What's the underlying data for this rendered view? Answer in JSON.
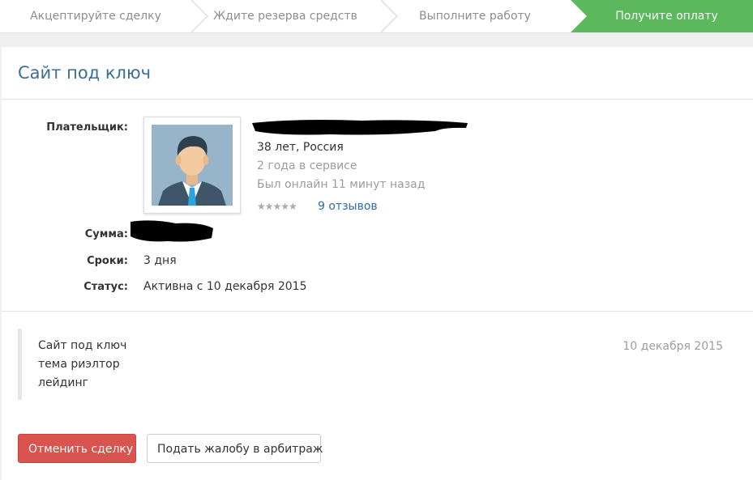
{
  "steps": [
    {
      "label": "Акцептируйте сделку",
      "active": false
    },
    {
      "label": "Ждите резерва средств",
      "active": false
    },
    {
      "label": "Выполните работу",
      "active": false
    },
    {
      "label": "Получите оплату",
      "active": true
    }
  ],
  "deal": {
    "title": "Сайт под ключ",
    "payer_label": "Плательщик:",
    "payer": {
      "age_country": "38 лет, Россия",
      "service_time": "2 года в сервисе",
      "last_online": "Был онлайн 11 минут назад",
      "stars": "★★★★★",
      "reviews": "9 отзывов"
    },
    "amount_label": "Сумма:",
    "terms_label": "Сроки:",
    "terms_value": "3 дня",
    "status_label": "Статус:",
    "status_value": "Активна с 10 декабря 2015"
  },
  "message": {
    "lines": [
      "Сайт под ключ",
      "тема риэлтор",
      "лейдинг"
    ],
    "date": "10 декабря 2015"
  },
  "actions": {
    "cancel_label": "Отменить сделку",
    "complain_label": "Подать жалобу в арбитраж"
  },
  "colors": {
    "accent": "#3a6e95",
    "step_active": "#5cb85c",
    "danger": "#d9534f",
    "link": "#2f6fa8"
  }
}
